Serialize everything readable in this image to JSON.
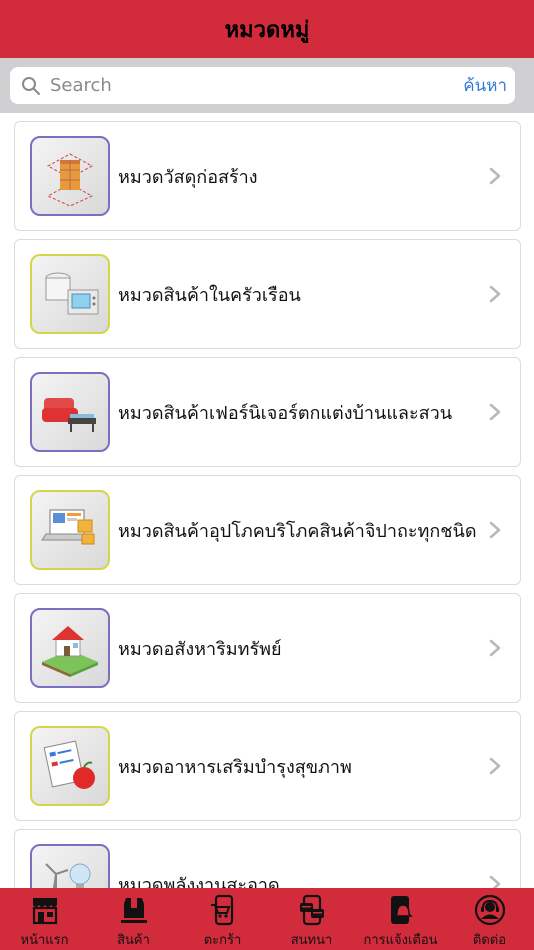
{
  "header": {
    "title": "หมวดหมู่"
  },
  "search": {
    "placeholder": "Search",
    "value": "",
    "button_label": "ค้นหา"
  },
  "categories": [
    {
      "label": "หมวดวัสดุก่อสร้าง",
      "icon": "construction-icon",
      "border": "#7a6fc0"
    },
    {
      "label": "หมวดสินค้าในครัวเรือน",
      "icon": "appliance-icon",
      "border": "#d4d64a"
    },
    {
      "label": "หมวดสินค้าเฟอร์นิเจอร์ตกแต่งบ้านและสวน",
      "icon": "sofa-icon",
      "border": "#7a6fc0"
    },
    {
      "label": "หมวดสินค้าอุปโภคบริโภคสินค้าจิปาถะทุกชนิด",
      "icon": "shopping-laptop-icon",
      "border": "#d4d64a"
    },
    {
      "label": "หมวดอสังหาริมทรัพย์",
      "icon": "house-icon",
      "border": "#7a6fc0"
    },
    {
      "label": "หมวดอาหารเสริมบำรุงสุขภาพ",
      "icon": "health-food-icon",
      "border": "#d4d64a"
    },
    {
      "label": "หมวดพลังงานสะอาด",
      "icon": "clean-energy-icon",
      "border": "#7a6fc0"
    }
  ],
  "tabs": [
    {
      "label": "หน้าแรก",
      "icon": "store-icon"
    },
    {
      "label": "สินค้า",
      "icon": "box-icon"
    },
    {
      "label": "ตะกร้า",
      "icon": "cart-phone-icon"
    },
    {
      "label": "สนทนา",
      "icon": "chat-phone-icon"
    },
    {
      "label": "การแจ้งเตือน",
      "icon": "bell-phone-icon"
    },
    {
      "label": "ติดต่อ",
      "icon": "support-icon"
    }
  ],
  "colors": {
    "brand": "#d22b3c",
    "link": "#2f7bdc"
  }
}
